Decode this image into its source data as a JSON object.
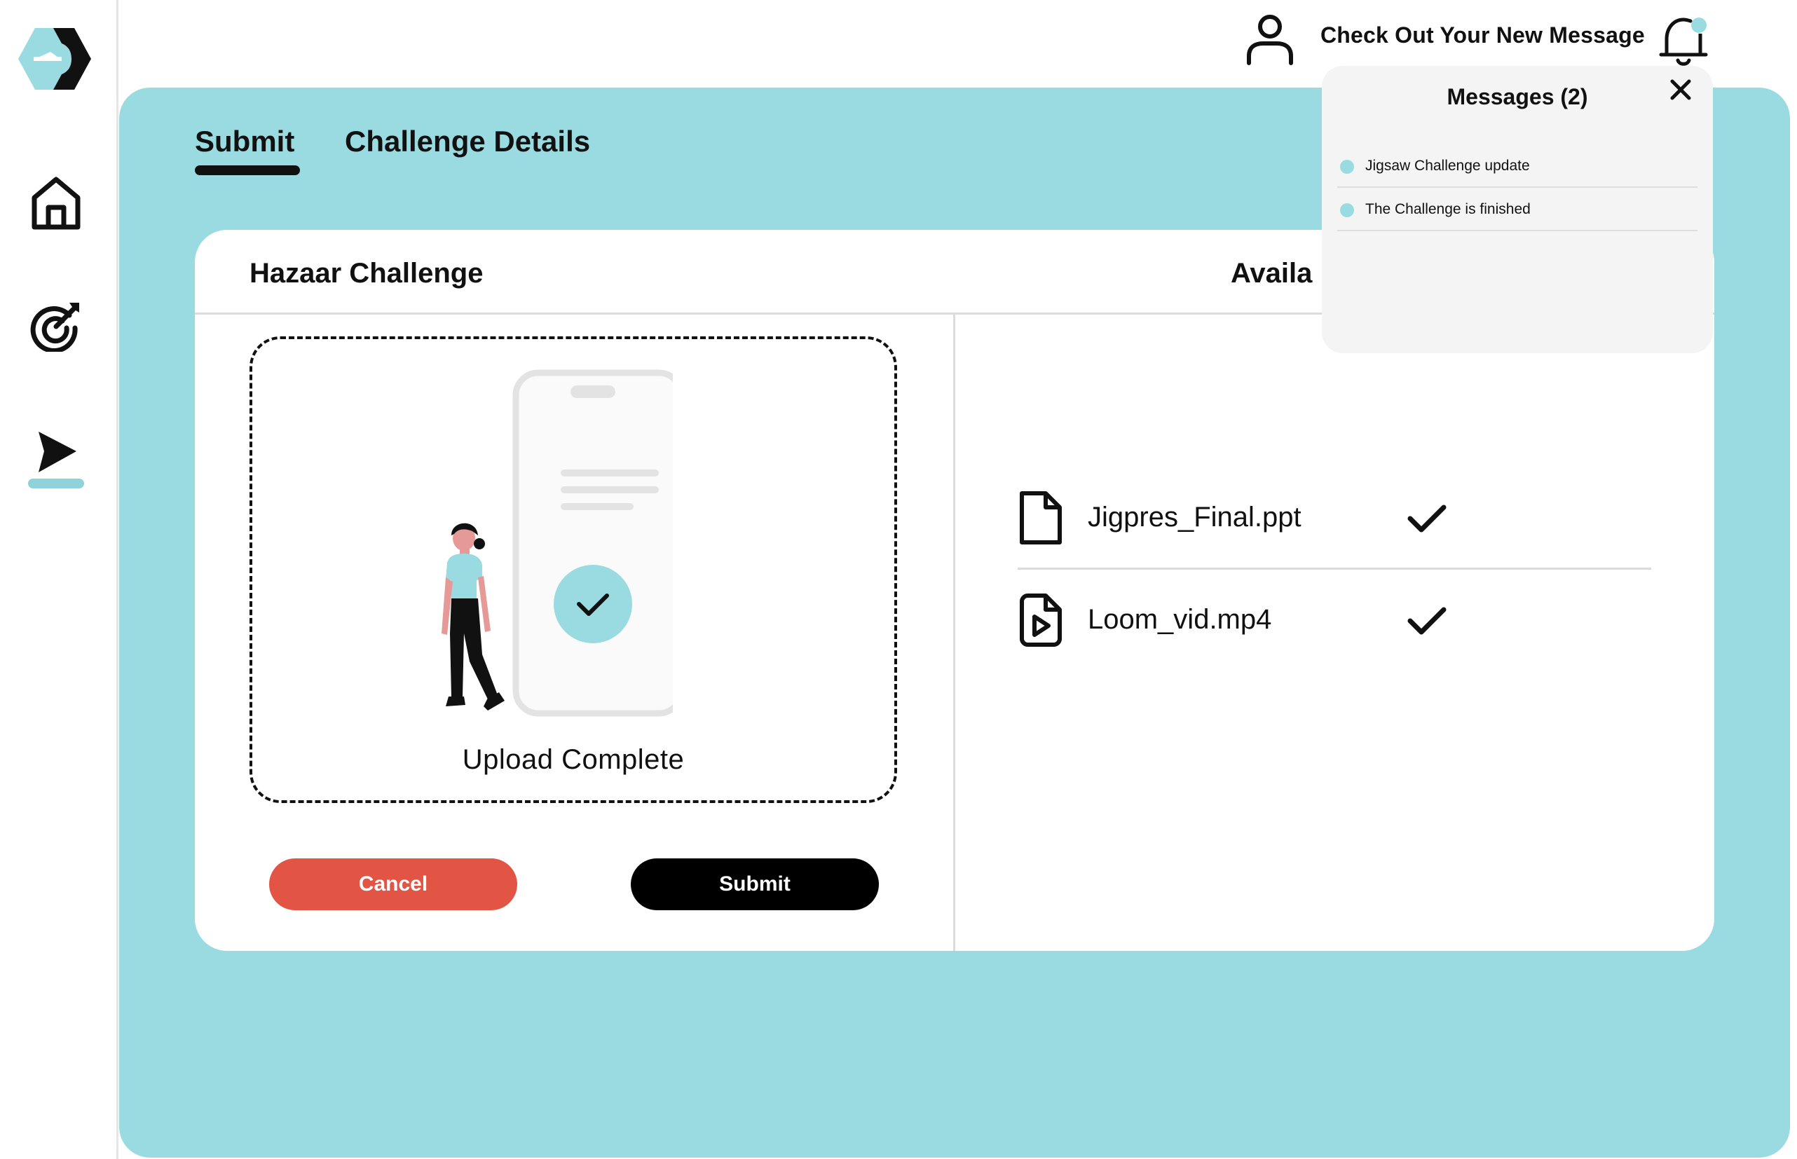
{
  "header": {
    "notification_text": "Check Out Your New Message"
  },
  "tabs": [
    {
      "label": "Submit",
      "active": true
    },
    {
      "label": "Challenge Details",
      "active": false
    }
  ],
  "card": {
    "title": "Hazaar Challenge",
    "right_title": "Availa",
    "upload_status": "Upload Complete",
    "cancel_label": "Cancel",
    "submit_label": "Submit",
    "files": [
      {
        "name": "Jigpres_Final.ppt",
        "icon": "document-icon",
        "uploaded": true
      },
      {
        "name": "Loom_vid.mp4",
        "icon": "video-file-icon",
        "uploaded": true
      }
    ]
  },
  "messages": {
    "title": "Messages (2)",
    "items": [
      {
        "text": "Jigsaw Challenge update",
        "unread": true
      },
      {
        "text": "The Challenge is finished",
        "unread": true
      }
    ]
  },
  "colors": {
    "accent": "#9adbe1",
    "cancel": "#e25443",
    "primary": "#000000",
    "illustration_skin": "#e59a98"
  },
  "icons": [
    "logo-icon",
    "home-icon",
    "target-icon",
    "send-icon",
    "user-icon",
    "bell-icon",
    "close-icon",
    "checkmark-icon"
  ]
}
